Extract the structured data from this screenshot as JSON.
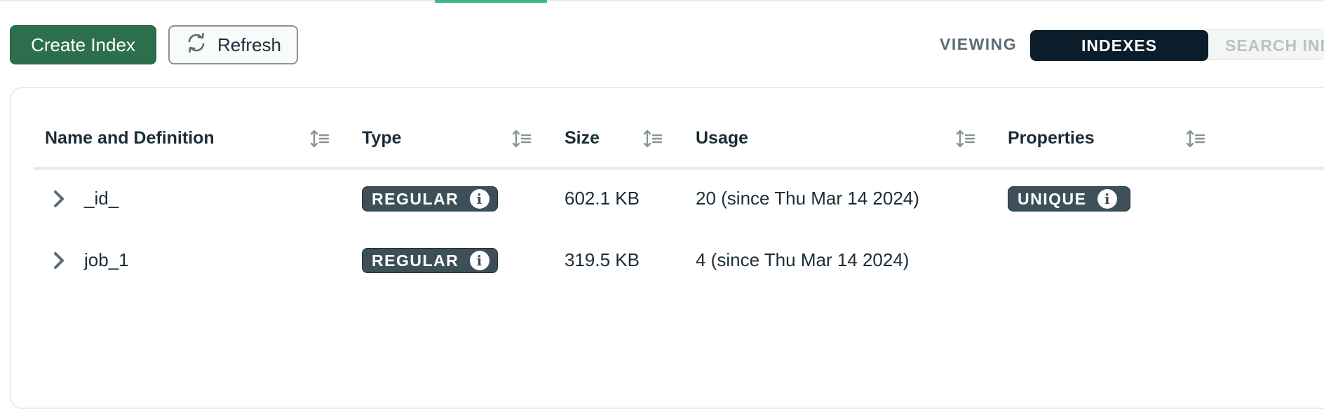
{
  "toolbar": {
    "create_label": "Create Index",
    "refresh_label": "Refresh",
    "viewing_label": "VIEWING",
    "segments": [
      "INDEXES",
      "SEARCH IND"
    ],
    "accent_color": "#2d6f4c"
  },
  "table": {
    "columns": [
      "Name and Definition",
      "Type",
      "Size",
      "Usage",
      "Properties"
    ],
    "rows": [
      {
        "name": "_id_",
        "type": "REGULAR",
        "size": "602.1 KB",
        "usage": "20 (since Thu Mar 14 2024)",
        "property": "UNIQUE"
      },
      {
        "name": "job_1",
        "type": "REGULAR",
        "size": "319.5 KB",
        "usage": "4 (since Thu Mar 14 2024)",
        "property": ""
      }
    ]
  },
  "icons": {
    "refresh": "refresh-icon",
    "sort": "sort-icon",
    "expand": "chevron-right-icon",
    "info": "info-icon"
  }
}
